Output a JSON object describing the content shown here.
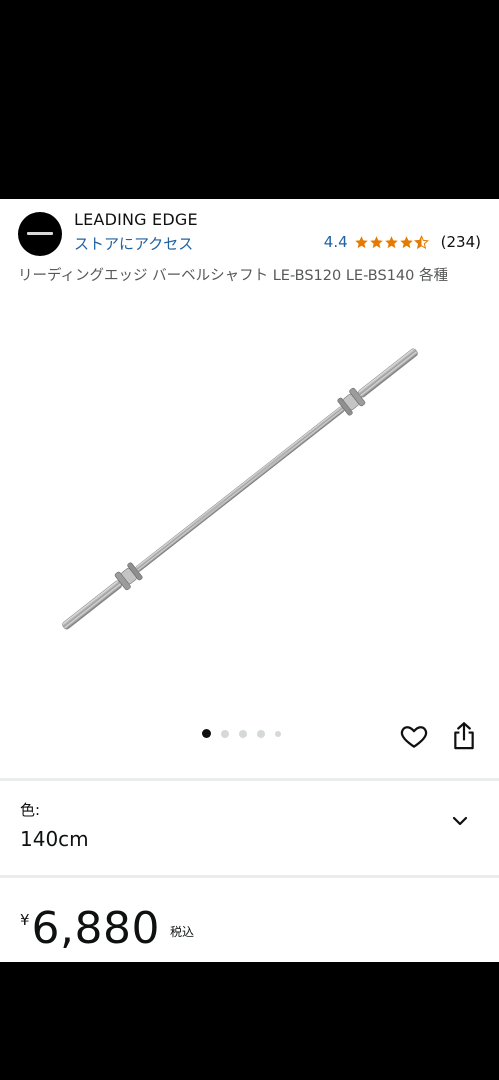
{
  "store": {
    "brand": "LEADING EDGE",
    "store_link": "ストアにアクセス",
    "rating_value": "4.4",
    "rating_stars": 4.4,
    "rating_count": "(234)",
    "star_color": "#e67a00",
    "link_color": "#2162a1"
  },
  "product": {
    "title": "リーディングエッジ バーベルシャフト LE-BS120 LE-BS140 各種",
    "image_icon": "barbell-shaft",
    "carousel_total": 5,
    "carousel_active": 1
  },
  "actions": {
    "wishlist_icon": "heart-icon",
    "share_icon": "share-icon"
  },
  "variation": {
    "label": "色:",
    "value": "140cm",
    "icon": "chevron-down-icon"
  },
  "price": {
    "currency": "¥",
    "amount": "6,880",
    "tax_label": "税込"
  }
}
